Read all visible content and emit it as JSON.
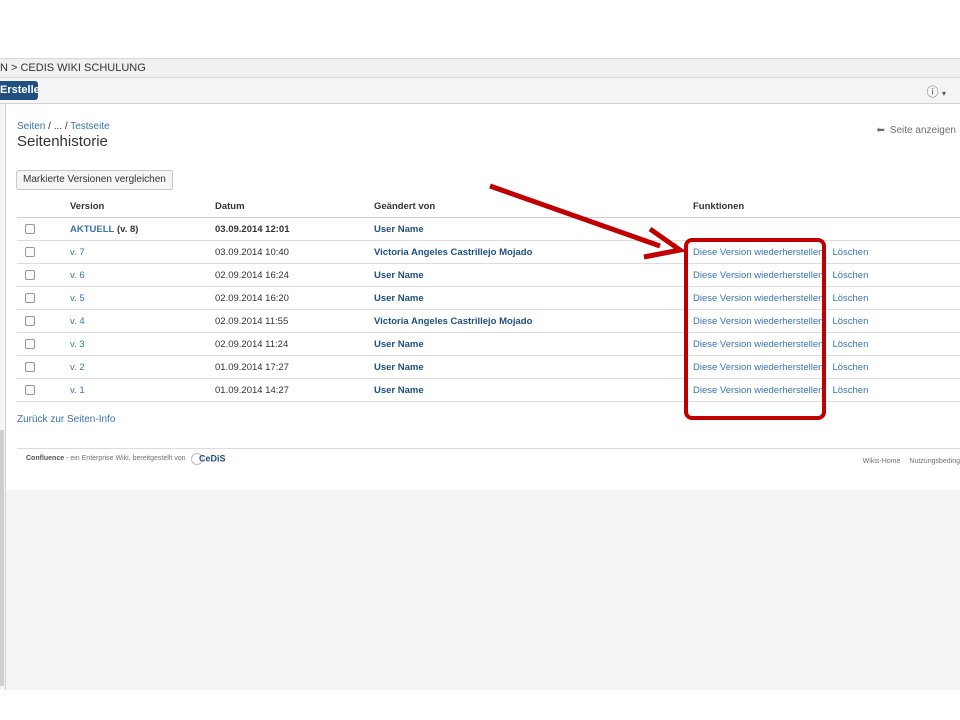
{
  "breadcrumb_bar": {
    "text": "N > CEDIS WIKI SCHULUNG"
  },
  "toolbar": {
    "create_label": "Erstellen",
    "help_icon": "help-icon"
  },
  "breadcrumb": {
    "root": "Seiten",
    "ellipsis": "...",
    "current": "Testseite",
    "separator": "/"
  },
  "page_title": "Seitenhistorie",
  "view_page_link": "Seite anzeigen",
  "compare_button": "Markierte Versionen vergleichen",
  "table": {
    "headers": {
      "version": "Version",
      "date": "Datum",
      "changed_by": "Geändert von",
      "functions": "Funktionen"
    },
    "current": {
      "label": "AKTUELL",
      "suffix": "(v. 8)",
      "date": "03.09.2014 12:01",
      "user": "User Name"
    },
    "rows": [
      {
        "version": "v. 7",
        "date": "03.09.2014 10:40",
        "user": "Victoria Angeles Castrillejo Mojado"
      },
      {
        "version": "v. 6",
        "date": "02.09.2014 16:24",
        "user": "User Name"
      },
      {
        "version": "v. 5",
        "date": "02.09.2014 16:20",
        "user": "User Name"
      },
      {
        "version": "v. 4",
        "date": "02.09.2014 11:55",
        "user": "Victoria Angeles Castrillejo Mojado"
      },
      {
        "version": "v. 3",
        "date": "02.09.2014 11:24",
        "user": "User Name"
      },
      {
        "version": "v. 2",
        "date": "01.09.2014 17:27",
        "user": "User Name"
      },
      {
        "version": "v. 1",
        "date": "01.09.2014 14:27",
        "user": "User Name"
      }
    ],
    "restore_label": "Diese Version wiederherstellen",
    "delete_label": "Löschen"
  },
  "back_link": "Zurück zur Seiten-Info",
  "footer": {
    "brand": "Confluence",
    "tagline": " - ein Enterprise Wiki, bereitgestellt von",
    "logo_text": "CeDiS",
    "links": [
      "Wikis-Home",
      "Nutzungsbeding"
    ]
  },
  "annotation": {
    "arrow_color": "#c00000",
    "box_color": "#c00000"
  }
}
